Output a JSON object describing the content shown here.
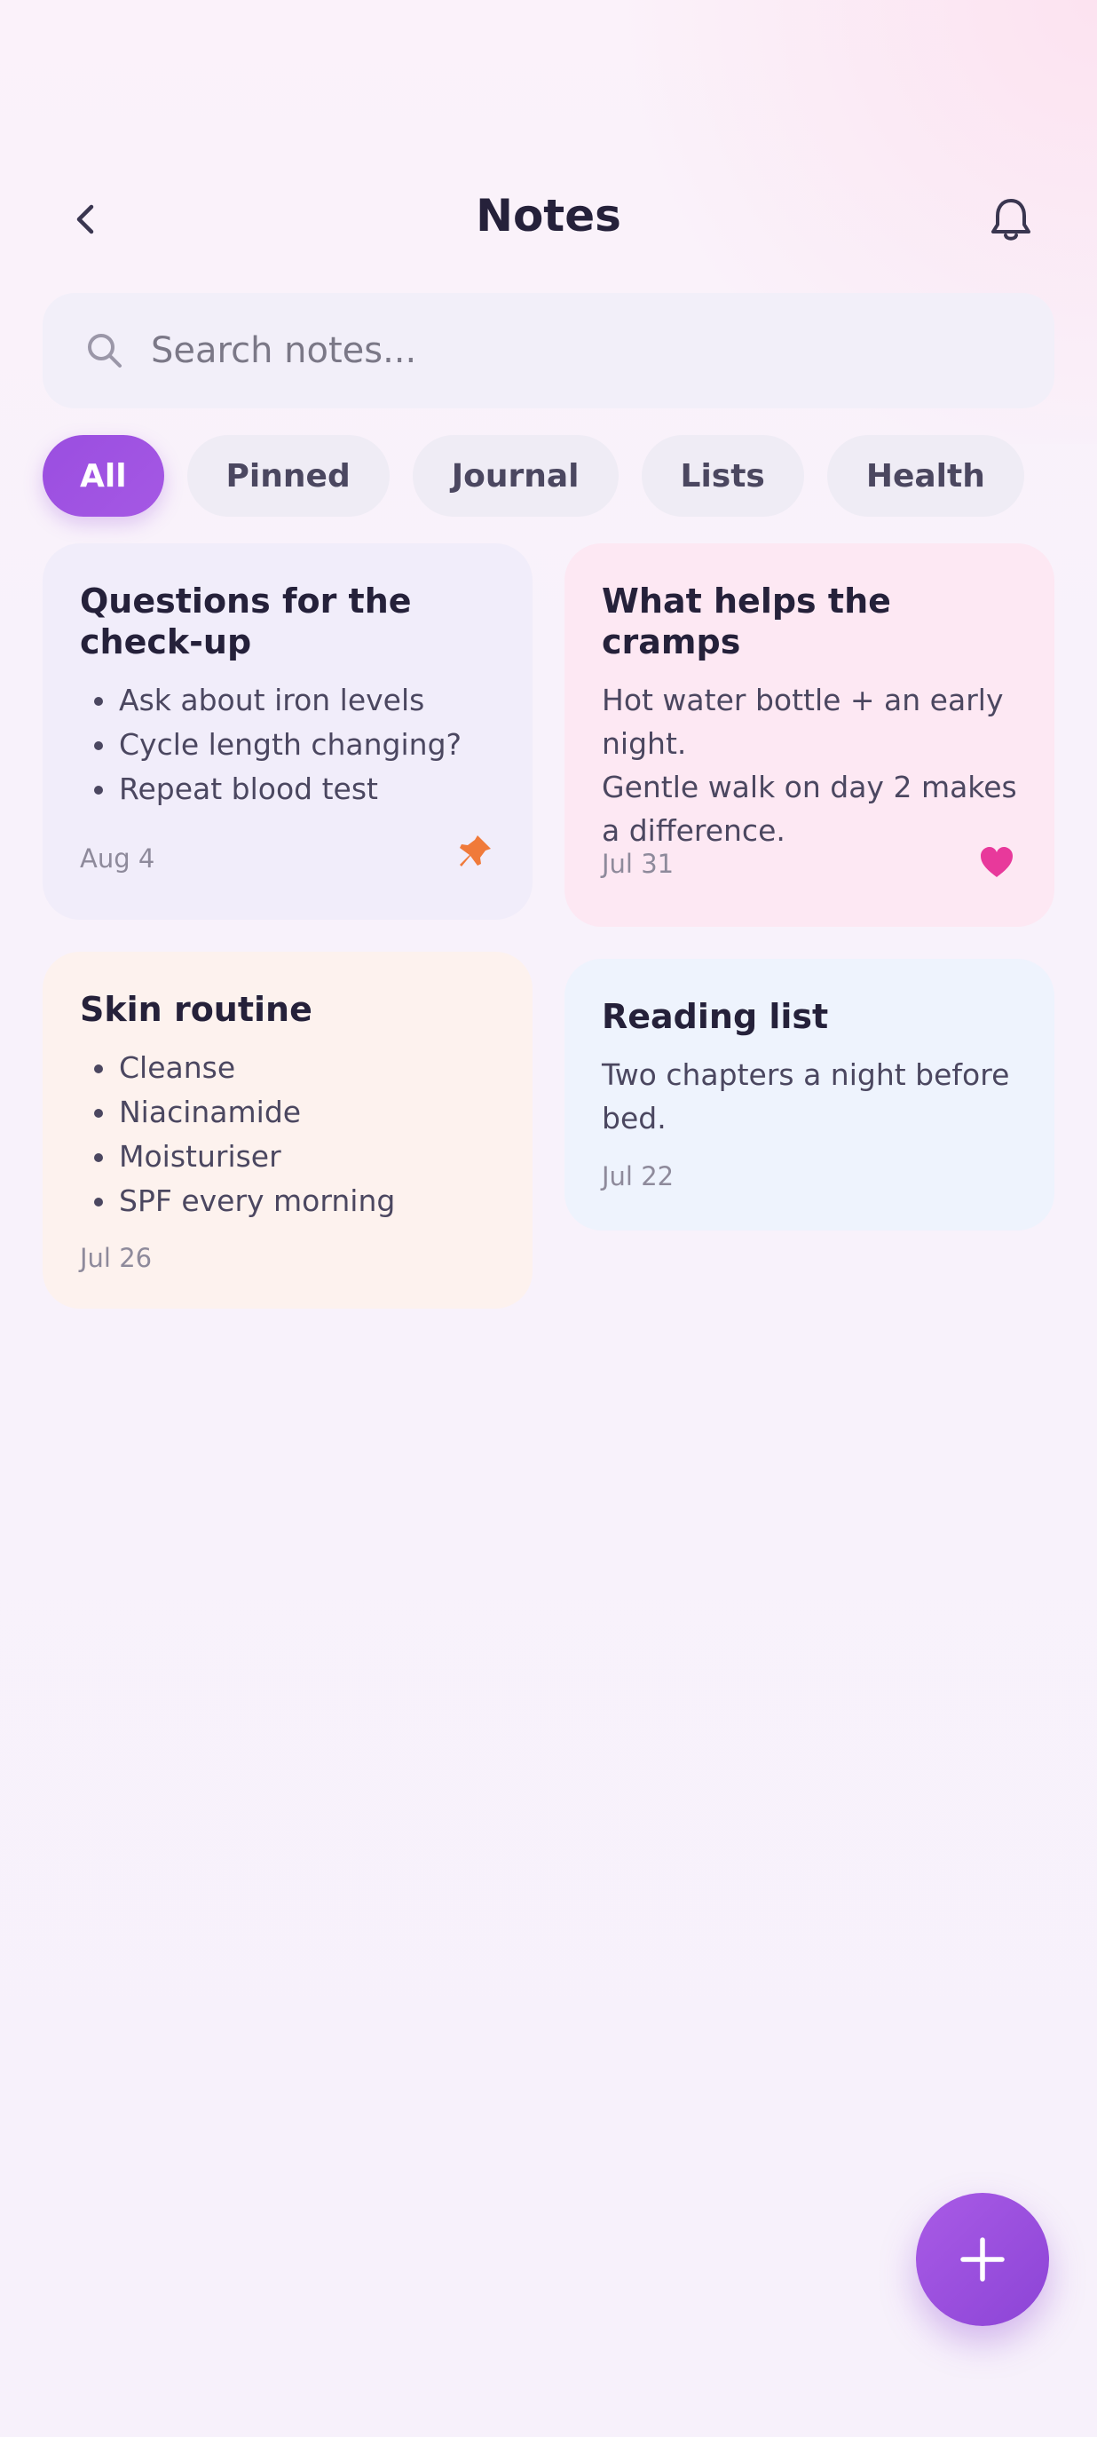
{
  "header": {
    "title": "Notes",
    "back_icon": "chevron-left-icon",
    "bell_icon": "bell-icon"
  },
  "search": {
    "placeholder": "Search notes...",
    "value": ""
  },
  "filters": [
    {
      "label": "All",
      "active": true
    },
    {
      "label": "Pinned",
      "active": false
    },
    {
      "label": "Journal",
      "active": false
    },
    {
      "label": "Lists",
      "active": false
    },
    {
      "label": "Health",
      "active": false
    }
  ],
  "notes": [
    {
      "title": "Questions for the check-up",
      "items": [
        "Ask about iron levels",
        "Cycle length changing?",
        "Repeat blood test"
      ],
      "date": "Aug 4",
      "badge": "pin-icon",
      "color": "#f1edfa"
    },
    {
      "title": "What helps the cramps",
      "lines": [
        "Hot water bottle + an early night.",
        "Gentle walk on day 2 makes a difference."
      ],
      "date": "Jul 31",
      "badge": "heart-icon",
      "color": "#fde8f3"
    },
    {
      "title": "Skin routine",
      "items": [
        "Cleanse",
        "Niacinamide",
        "Moisturiser",
        "SPF every morning"
      ],
      "date": "Jul 26",
      "color": "#fdf2ee"
    },
    {
      "title": "Reading list",
      "lines": [
        "Two chapters a night before bed."
      ],
      "date": "Jul 22",
      "color": "#eef3fd"
    }
  ],
  "fab": {
    "icon": "plus-icon"
  },
  "colors": {
    "accent": "#9a4ee0",
    "pin": "#f07a3a",
    "heart": "#e8399b"
  }
}
